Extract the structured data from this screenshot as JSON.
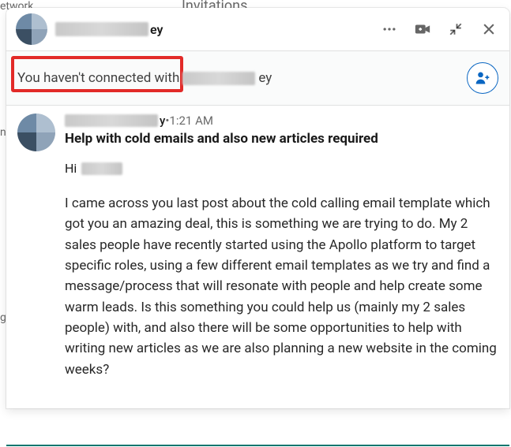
{
  "background": {
    "network_label": "etwork",
    "invitations_label": "Invitations",
    "edge_letter_1": "n",
    "edge_letter_2": "g"
  },
  "header": {
    "name_suffix": "ey"
  },
  "notice": {
    "prefix": "You haven't connected with",
    "name_suffix": "ey"
  },
  "message": {
    "sender_suffix": "y",
    "separator": " • ",
    "time": "1:21 AM",
    "subject": "Help with cold emails and also new articles required",
    "greeting": "Hi",
    "body": "I came across you last post about the cold calling email template which  got you an amazing deal, this is something we are trying to do.  My 2 sales people have recently started using the Apollo platform to target specific roles, using a few different email templates as we try and find a message/process that will resonate with people and help create some warm leads.  Is this something you could help us (mainly my 2 sales people) with, and also there will be some opportunities to help with writing new articles as we are also planning a new website in the coming weeks?"
  }
}
